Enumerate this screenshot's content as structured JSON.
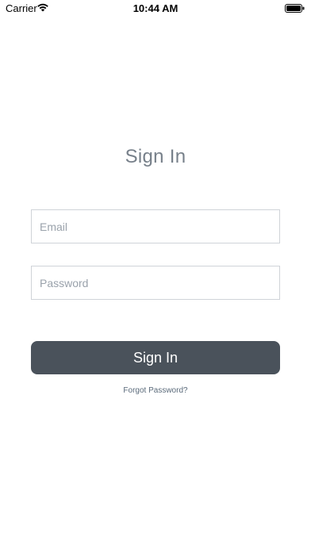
{
  "status_bar": {
    "carrier": "Carrier",
    "time": "10:44 AM",
    "wifi_icon": "wifi-icon",
    "battery_icon": "battery-icon",
    "battery_level": 1.0
  },
  "signin": {
    "title": "Sign In",
    "email_placeholder": "Email",
    "email_value": "",
    "password_placeholder": "Password",
    "password_value": "",
    "button_label": "Sign In",
    "forgot_link": "Forgot Password?"
  },
  "colors": {
    "title": "#77808a",
    "button_bg": "#4a525b",
    "field_border": "#cfd3d8",
    "link": "#5b6b7b"
  }
}
